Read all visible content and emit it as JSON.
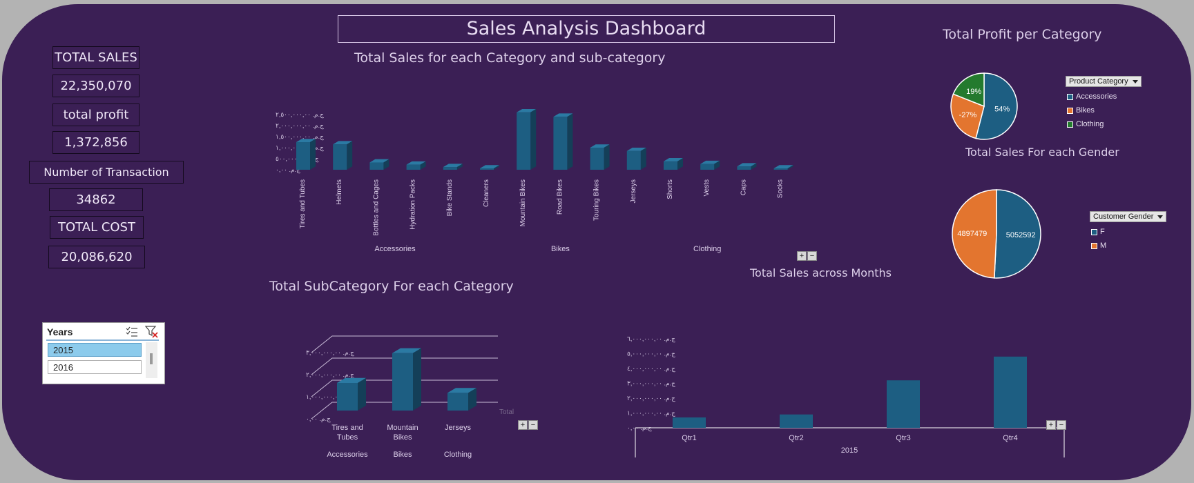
{
  "dashboard": {
    "title": "Sales Analysis Dashboard"
  },
  "kpis": {
    "total_sales_label": "TOTAL SALES",
    "total_sales_value": "22,350,070",
    "total_profit_label": "total profit",
    "total_profit_value": "1,372,856",
    "transactions_label": "Number  of  Transaction",
    "transactions_value": "34862",
    "total_cost_label": "TOTAL COST",
    "total_cost_value": "20,086,620"
  },
  "slicer": {
    "title": "Years",
    "items": [
      "2015",
      "2016"
    ],
    "selected": "2015"
  },
  "colors": {
    "bar": "#1d5e82",
    "bar_top": "#2b7aa3",
    "bar_side": "#143f58",
    "accessories": "#1d5e82",
    "bikes": "#e3752f",
    "clothing": "#247a2e",
    "female": "#1d5e82",
    "male": "#e3752f"
  },
  "chart_data": [
    {
      "id": "sales_by_subcategory",
      "type": "bar",
      "title": "Total Sales for each Category and sub-category",
      "categories": [
        "Tires and Tubes",
        "Helmets",
        "Bottles and Cages",
        "Hydration Packs",
        "Bike Stands",
        "Cleaners",
        "Mountain Bikes",
        "Road Bikes",
        "Touring Bikes",
        "Jerseys",
        "Shorts",
        "Vests",
        "Caps",
        "Socks"
      ],
      "groups": [
        {
          "name": "Accessories",
          "count": 6
        },
        {
          "name": "Bikes",
          "count": 3
        },
        {
          "name": "Clothing",
          "count": 5
        }
      ],
      "values": [
        1250000,
        1150000,
        330000,
        230000,
        120000,
        60000,
        2600000,
        2400000,
        1000000,
        850000,
        380000,
        260000,
        150000,
        60000
      ],
      "ylim": [
        0,
        2500000
      ],
      "yticks": [
        0,
        500000,
        1000000,
        1500000,
        2000000,
        2500000
      ],
      "ytick_labels": [
        "ج.م.‏ ٠,٠٠",
        "ج.م.‏ ٥٠٠,٠٠٠,٠٠",
        "ج.م.‏ ١,٠٠٠,٠٠٠,٠٠",
        "ج.م.‏ ١,٥٠٠,٠٠٠,٠٠",
        "ج.م.‏ ٢,٠٠٠,٠٠٠,٠٠",
        "ج.م.‏ ٢,٥٠٠,٠٠٠,٠٠"
      ]
    },
    {
      "id": "profit_by_category",
      "type": "pie",
      "title": "Total Profit per Category",
      "labels": [
        "Accessories",
        "Bikes",
        "Clothing"
      ],
      "values": [
        54,
        27,
        19
      ],
      "value_labels": [
        "54%",
        "-27%",
        "19%"
      ],
      "legend_title": "Product Category",
      "legend": [
        "Accessories",
        "Bikes",
        "Clothing"
      ]
    },
    {
      "id": "sales_by_gender",
      "type": "pie",
      "title": "Total Sales For each Gender",
      "labels": [
        "F",
        "M"
      ],
      "values": [
        5052592,
        4897479
      ],
      "value_labels": [
        "5052592",
        "4897479"
      ],
      "legend_title": "Customer Gender",
      "legend": [
        "F",
        "M"
      ]
    },
    {
      "id": "subcategory_by_category",
      "type": "bar",
      "title": "Total SubCategory For each Category",
      "categories": [
        "Tires and Tubes",
        "Mountain Bikes",
        "Jerseys"
      ],
      "groups": [
        "Accessories",
        "Bikes",
        "Clothing"
      ],
      "values": [
        1250000,
        2600000,
        800000
      ],
      "ylim": [
        0,
        4000000
      ],
      "yticks": [
        0,
        1000000,
        2000000,
        3000000
      ],
      "ytick_labels": [
        "ج.م.‏ ٠,٠٠",
        "ج.م.‏ ١,٠٠٠,٠٠٠,٠٠",
        "ج.م.‏ ٢,٠٠٠,٠٠٠,٠٠",
        "ج.م.‏ ٣,٠٠٠,٠٠٠,٠٠"
      ],
      "series_label": "Total"
    },
    {
      "id": "sales_across_months",
      "type": "bar",
      "title": "Total Sales across Months",
      "categories": [
        "Qtr1",
        "Qtr2",
        "Qtr3",
        "Qtr4"
      ],
      "group": "2015",
      "values": [
        700000,
        900000,
        3200000,
        4800000
      ],
      "ylim": [
        0,
        6000000
      ],
      "yticks": [
        0,
        1000000,
        2000000,
        3000000,
        4000000,
        5000000,
        6000000
      ],
      "ytick_labels": [
        "ج.م.‏ ٠,٠٠",
        "ج.م.‏ ١,٠٠٠,٠٠٠,٠٠",
        "ج.م.‏ ٢,٠٠٠,٠٠٠,٠٠",
        "ج.م.‏ ٣,٠٠٠,٠٠٠,٠٠",
        "ج.م.‏ ٤,٠٠٠,٠٠٠,٠٠",
        "ج.م.‏ ٥,٠٠٠,٠٠٠,٠٠",
        "ج.م.‏ ٦,٠٠٠,٠٠٠,٠٠"
      ]
    }
  ]
}
